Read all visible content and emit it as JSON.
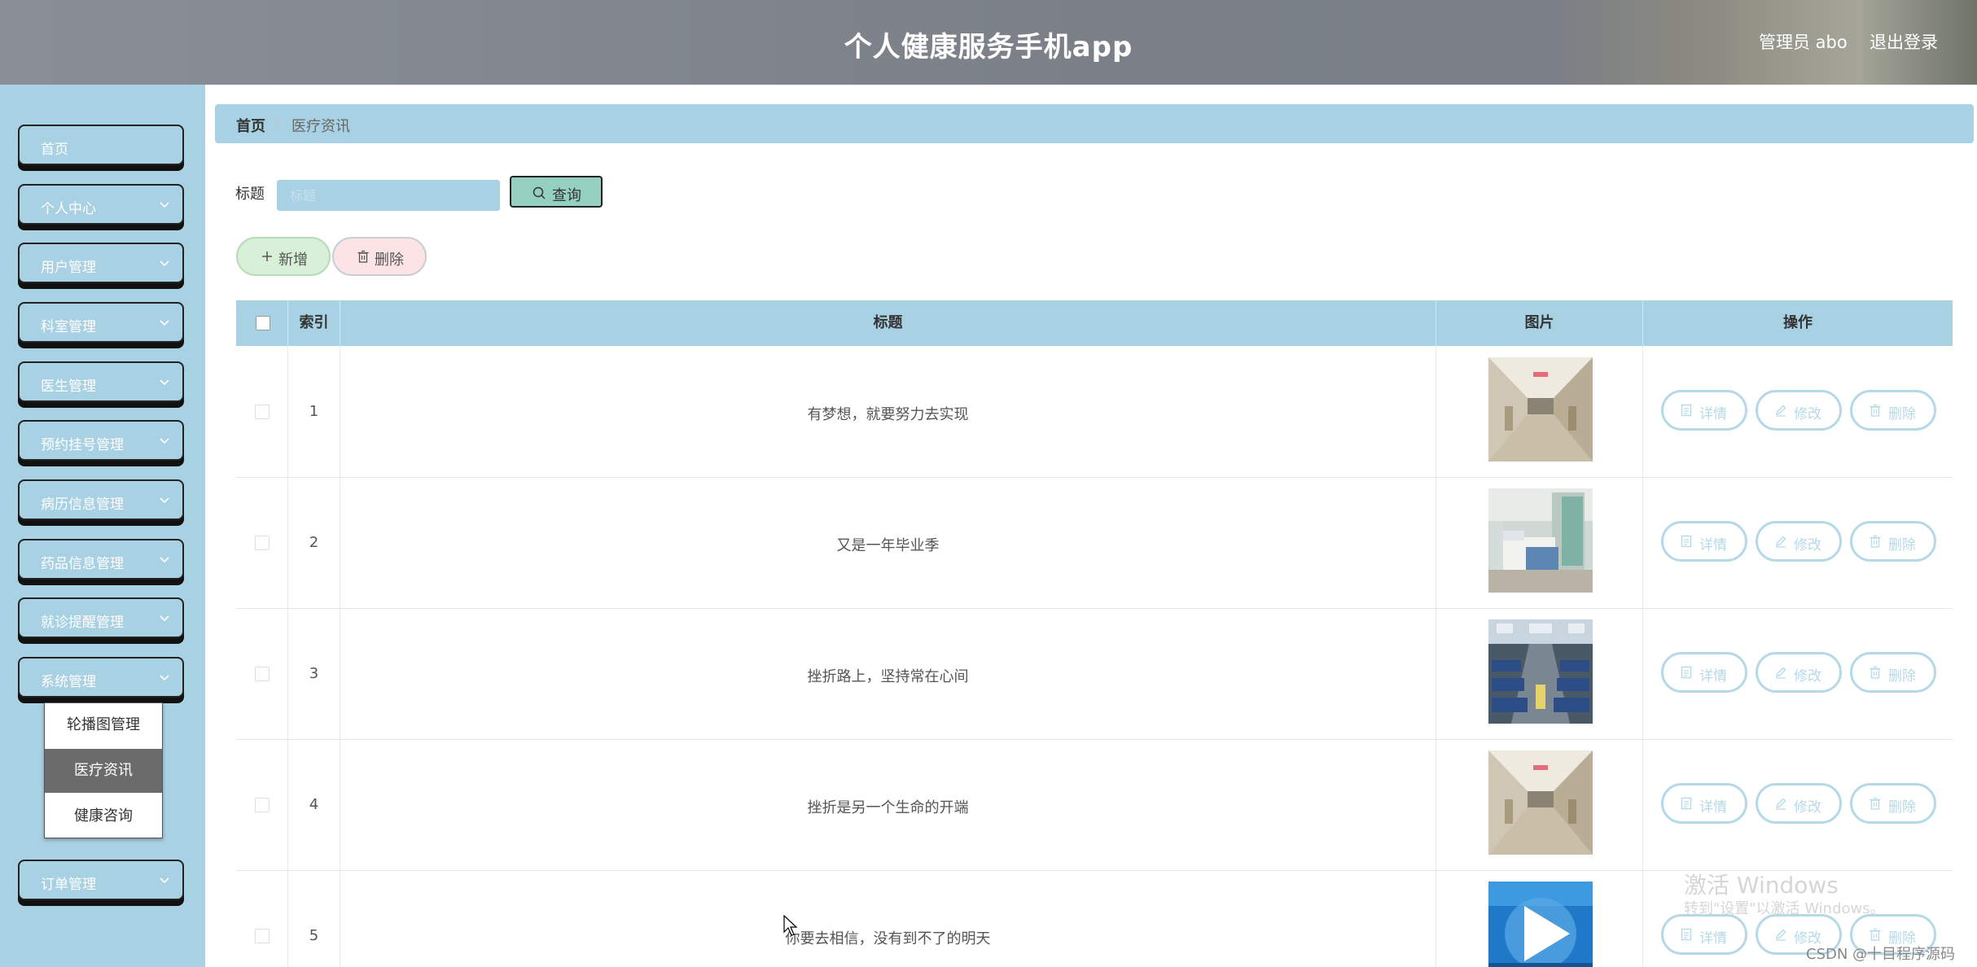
{
  "header": {
    "title": "个人健康服务手机app",
    "user": "管理员 abo",
    "logout": "退出登录"
  },
  "sidebar": {
    "items": [
      {
        "label": "首页",
        "has_arrow": false
      },
      {
        "label": "个人中心",
        "has_arrow": true
      },
      {
        "label": "用户管理",
        "has_arrow": true
      },
      {
        "label": "科室管理",
        "has_arrow": true
      },
      {
        "label": "医生管理",
        "has_arrow": true
      },
      {
        "label": "预约挂号管理",
        "has_arrow": true
      },
      {
        "label": "病历信息管理",
        "has_arrow": true
      },
      {
        "label": "药品信息管理",
        "has_arrow": true
      },
      {
        "label": "就诊提醒管理",
        "has_arrow": true
      },
      {
        "label": "系统管理",
        "has_arrow": true
      },
      {
        "label": "订单管理",
        "has_arrow": true
      }
    ],
    "submenu": [
      {
        "label": "轮播图管理",
        "active": false
      },
      {
        "label": "医疗资讯",
        "active": true
      },
      {
        "label": "健康咨询",
        "active": false
      }
    ]
  },
  "breadcrumb": {
    "home": "首页",
    "separator": "/",
    "current": "医疗资讯"
  },
  "search": {
    "label": "标题",
    "placeholder": "标题",
    "value": "",
    "button": "查询"
  },
  "actions": {
    "add": "新增",
    "delete": "删除"
  },
  "table": {
    "columns": [
      "索引",
      "标题",
      "图片",
      "操作"
    ],
    "rows": [
      {
        "index": "1",
        "title": "有梦想，就要努力去实现",
        "image": "hospital-corridor"
      },
      {
        "index": "2",
        "title": "又是一年毕业季",
        "image": "hospital-ward"
      },
      {
        "index": "3",
        "title": "挫折路上，坚持常在心间",
        "image": "waiting-hall"
      },
      {
        "index": "4",
        "title": "挫折是另一个生命的开端",
        "image": "hospital-corridor"
      },
      {
        "index": "5",
        "title": "你要去相信，没有到不了的明天",
        "image": "blue-medical"
      }
    ],
    "row_actions": {
      "detail": "详情",
      "edit": "修改",
      "delete": "删除"
    }
  },
  "overlay": {
    "windows_line1": "激活 Windows",
    "windows_line2": "转到\"设置\"以激活 Windows。",
    "csdn": "CSDN @十目程序源码"
  },
  "colors": {
    "accent": "#a8d1e3",
    "query_button": "#94d0bf",
    "add_button": "#d7f0d7",
    "delete_button": "#fbe3e6",
    "active_submenu": "#6b6b6b"
  }
}
